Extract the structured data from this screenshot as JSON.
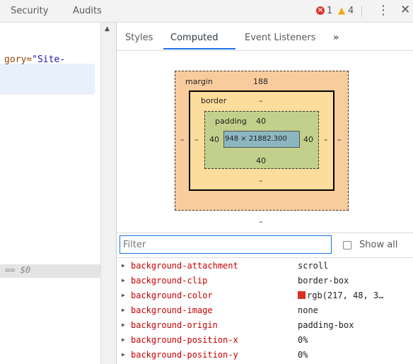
{
  "topbar": {
    "tabs": [
      "Security",
      "Audits"
    ],
    "error_count": "1",
    "warning_count": "4",
    "kebab_glyph": "⋮",
    "close_glyph": "✕"
  },
  "elements": {
    "code_attr_name": "gory=",
    "code_attr_value": "\"Site-",
    "selected_marker": "== $0"
  },
  "sidebar": {
    "tabs": {
      "styles": "Styles",
      "computed": "Computed",
      "event_listeners": "Event Listeners",
      "more": "»"
    },
    "box_model": {
      "margin_label": "margin",
      "margin_top": "188",
      "margin_bottom": "–",
      "margin_left": "–",
      "margin_right": "–",
      "border_label": "border",
      "border_top": "–",
      "border_bottom": "–",
      "border_left": "–",
      "border_right": "–",
      "padding_label": "padding",
      "padding_top": "40",
      "padding_bottom": "40",
      "padding_left": "40",
      "padding_right": "40",
      "content": "948 × 21882.300"
    },
    "filter": {
      "placeholder": "Filter",
      "show_all_label": "Show all"
    },
    "properties": [
      {
        "name": "background-attachment",
        "value": "scroll"
      },
      {
        "name": "background-clip",
        "value": "border-box"
      },
      {
        "name": "background-color",
        "value": "rgb(217, 48, 3…",
        "swatch": "#d93025"
      },
      {
        "name": "background-image",
        "value": "none"
      },
      {
        "name": "background-origin",
        "value": "padding-box"
      },
      {
        "name": "background-position-x",
        "value": "0%"
      },
      {
        "name": "background-position-y",
        "value": "0%"
      }
    ]
  },
  "colors": {
    "accent": "#1a73e8",
    "margin": "#f9cc9d",
    "border": "#fddd9b",
    "padding": "#c3d08b",
    "content": "#8cb6c0",
    "property_name": "#c80000"
  }
}
